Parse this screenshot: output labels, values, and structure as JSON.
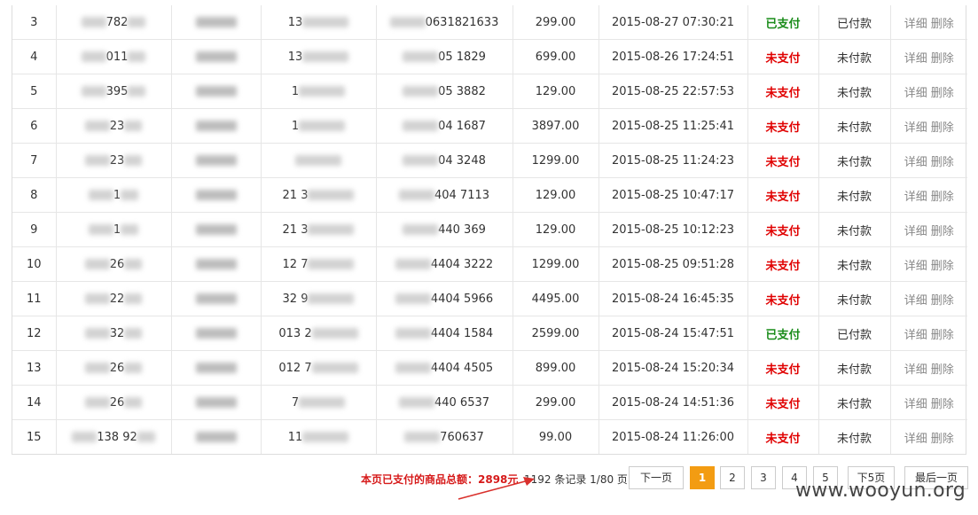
{
  "orders": [
    {
      "no": "3",
      "id_visible": "782",
      "phone_visible": "13",
      "order_visible": "0631821633",
      "amount": "299.00",
      "time": "2015-08-27 07:30:21",
      "status": "已支付",
      "status_type": "paid",
      "refund": "已付款"
    },
    {
      "no": "4",
      "id_visible": "011",
      "phone_visible": "13",
      "order_visible": "05        1829",
      "amount": "699.00",
      "time": "2015-08-26 17:24:51",
      "status": "未支付",
      "status_type": "unpaid",
      "refund": "未付款"
    },
    {
      "no": "5",
      "id_visible": "395",
      "phone_visible": "1",
      "order_visible": "05        3882",
      "amount": "129.00",
      "time": "2015-08-25 22:57:53",
      "status": "未支付",
      "status_type": "unpaid",
      "refund": "未付款"
    },
    {
      "no": "6",
      "id_visible": "23",
      "phone_visible": "1",
      "order_visible": "04        1687",
      "amount": "3897.00",
      "time": "2015-08-25 11:25:41",
      "status": "未支付",
      "status_type": "unpaid",
      "refund": "未付款"
    },
    {
      "no": "7",
      "id_visible": "23",
      "phone_visible": "",
      "order_visible": "04        3248",
      "amount": "1299.00",
      "time": "2015-08-25 11:24:23",
      "status": "未支付",
      "status_type": "unpaid",
      "refund": "未付款"
    },
    {
      "no": "8",
      "id_visible": "1",
      "phone_visible": "21    3",
      "order_visible": "404      7113",
      "amount": "129.00",
      "time": "2015-08-25 10:47:17",
      "status": "未支付",
      "status_type": "unpaid",
      "refund": "未付款"
    },
    {
      "no": "9",
      "id_visible": "1",
      "phone_visible": "21    3",
      "order_visible": "440      369",
      "amount": "129.00",
      "time": "2015-08-25 10:12:23",
      "status": "未支付",
      "status_type": "unpaid",
      "refund": "未付款"
    },
    {
      "no": "10",
      "id_visible": "26",
      "phone_visible": "12     7",
      "order_visible": "4404     3222",
      "amount": "1299.00",
      "time": "2015-08-25 09:51:28",
      "status": "未支付",
      "status_type": "unpaid",
      "refund": "未付款"
    },
    {
      "no": "11",
      "id_visible": "22",
      "phone_visible": "32    9",
      "order_visible": "4404     5966",
      "amount": "4495.00",
      "time": "2015-08-24 16:45:35",
      "status": "未支付",
      "status_type": "unpaid",
      "refund": "未付款"
    },
    {
      "no": "12",
      "id_visible": "32",
      "phone_visible": "013    2",
      "order_visible": "4404     1584",
      "amount": "2599.00",
      "time": "2015-08-24 15:47:51",
      "status": "已支付",
      "status_type": "paid",
      "refund": "已付款"
    },
    {
      "no": "13",
      "id_visible": "26",
      "phone_visible": "012    7",
      "order_visible": "4404     4505",
      "amount": "899.00",
      "time": "2015-08-24 15:20:34",
      "status": "未支付",
      "status_type": "unpaid",
      "refund": "未付款"
    },
    {
      "no": "14",
      "id_visible": "26",
      "phone_visible": "       7",
      "order_visible": "440      6537",
      "amount": "299.00",
      "time": "2015-08-24 14:51:36",
      "status": "未支付",
      "status_type": "unpaid",
      "refund": "未付款"
    },
    {
      "no": "15",
      "id_visible": "138      92",
      "phone_visible": "11",
      "order_visible": "760637",
      "amount": "99.00",
      "time": "2015-08-24 11:26:00",
      "status": "未支付",
      "status_type": "unpaid",
      "refund": "未付款"
    }
  ],
  "actions": {
    "detail": "详细",
    "delete": "删除"
  },
  "pagination": {
    "summary": "本页已支付的商品总额：2898元",
    "records": "1192 条记录 1/80 页",
    "prev": "下一页",
    "pages": [
      "1",
      "2",
      "3",
      "4",
      "5"
    ],
    "active_page": "1",
    "next5": "下5页",
    "last": "最后一页"
  },
  "watermark": "www.wooyun.org",
  "colors": {
    "paid": "#1a8c1a",
    "unpaid": "#e00000",
    "active_page": "#f39c12",
    "summary": "#d61a1a",
    "arrow": "#d9302c"
  }
}
